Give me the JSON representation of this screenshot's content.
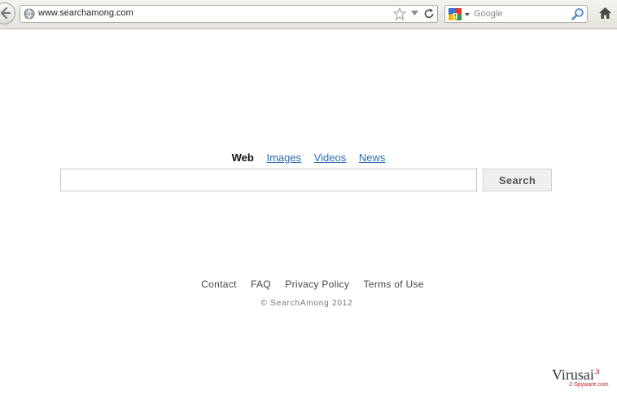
{
  "browser": {
    "url": "www.searchamong.com",
    "search_placeholder": "Google"
  },
  "page": {
    "tabs": [
      {
        "label": "Web",
        "active": true
      },
      {
        "label": "Images",
        "active": false
      },
      {
        "label": "Videos",
        "active": false
      },
      {
        "label": "News",
        "active": false
      }
    ],
    "search_input_value": "",
    "search_button_label": "Search",
    "footer_links": [
      "Contact",
      "FAQ",
      "Privacy Policy",
      "Terms of Use"
    ],
    "copyright": "© SearchAmong 2012"
  },
  "watermark": {
    "brand": "Virusai",
    "tld": ".lt",
    "sub": "2-Spyware.com"
  },
  "icons": {
    "back": "back-arrow-icon",
    "site": "globe-icon",
    "bookmark": "star-icon",
    "history": "dropdown-arrow-icon",
    "reload": "reload-icon",
    "engine": "google-logo-icon",
    "search": "magnifier-icon",
    "home": "home-icon"
  },
  "colors": {
    "link": "#2a6bb5",
    "toolbar": "#e9e7df",
    "watermark_red": "#b22222"
  }
}
